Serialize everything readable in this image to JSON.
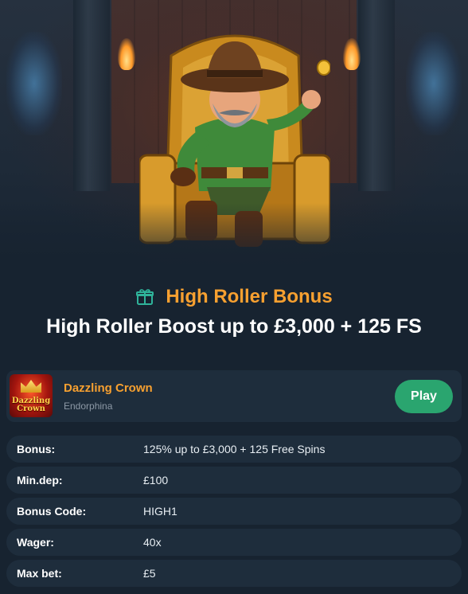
{
  "hero": {
    "image_subject": "character-on-throne-image"
  },
  "bonus": {
    "type_label": "High Roller Bonus",
    "headline": "High Roller Boost up to £3,000 + 125 FS"
  },
  "game": {
    "thumbnail_text_1": "Dazzling",
    "thumbnail_text_2": "Crown",
    "name": "Dazzling Crown",
    "provider": "Endorphina",
    "play_label": "Play"
  },
  "details": [
    {
      "label": "Bonus:",
      "value": "125% up to £3,000 + 125 Free Spins"
    },
    {
      "label": "Min.dep:",
      "value": "£100"
    },
    {
      "label": "Bonus Code:",
      "value": "HIGH1"
    },
    {
      "label": "Wager:",
      "value": "40x"
    },
    {
      "label": "Max bet:",
      "value": "£5"
    }
  ],
  "colors": {
    "background": "#172330",
    "card": "#1e2d3c",
    "accent_orange": "#f7a030",
    "play_green": "#2aa56f",
    "gift_teal": "#2fb39a"
  },
  "icons": {
    "bonus_type": "gift-icon"
  }
}
